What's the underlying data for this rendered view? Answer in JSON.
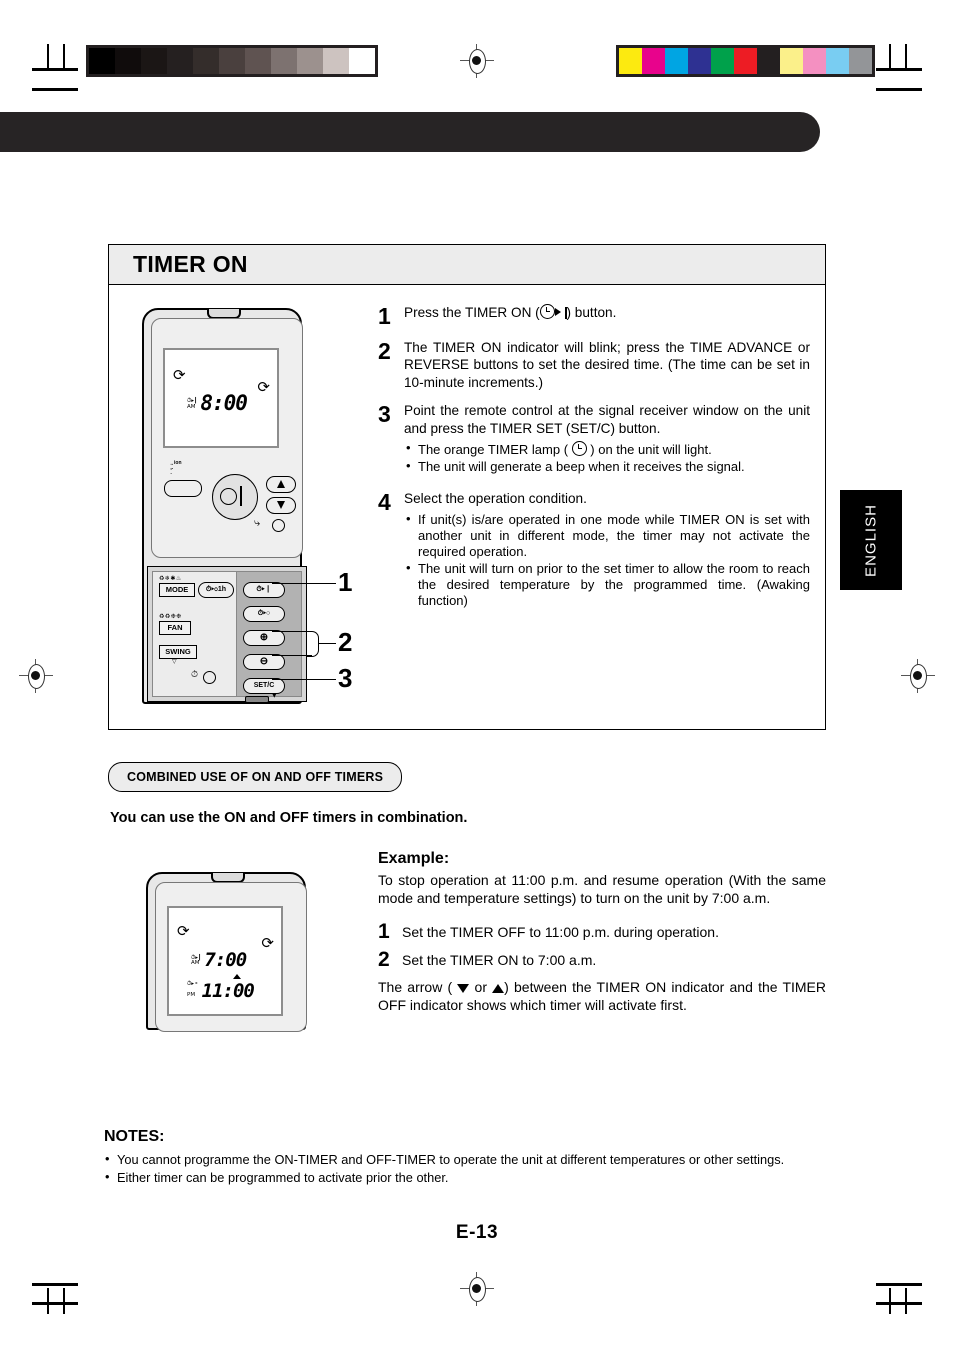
{
  "page": {
    "number_label": "E-13",
    "language_tab": "ENGLISH"
  },
  "colorbars": {
    "grayscale": [
      "#000000",
      "#100c0c",
      "#1b1615",
      "#252020",
      "#342d2b",
      "#4a403e",
      "#5f5351",
      "#7d7270",
      "#9c918e",
      "#cdc3c0",
      "#ffffff"
    ],
    "process": [
      "#fcea10",
      "#e8038c",
      "#00a5e3",
      "#2e3192",
      "#00a14b",
      "#ed1c24",
      "#231f20",
      "#fbf08a",
      "#f490c1",
      "#79cdf2",
      "#939598"
    ]
  },
  "panel": {
    "title": "TIMER ON",
    "steps": [
      {
        "num": "1",
        "text_before": "Press the TIMER ON (",
        "icon": "timer-on-icon",
        "text_after": ") button."
      },
      {
        "num": "2",
        "text": "The TIMER ON indicator will blink; press the TIME ADVANCE or REVERSE buttons to set the desired time. (The time can be set in 10-minute increments.)"
      },
      {
        "num": "3",
        "text": "Point the remote control at the signal receiver window on the unit and press the TIMER SET (SET/C) button.",
        "bullets_before_icon": "The orange TIMER lamp (",
        "bullets_after_icon": ") on the unit will light.",
        "bullet2": "The unit will generate a beep when it receives the signal."
      },
      {
        "num": "4",
        "text": "Select the operation condition.",
        "bullet1": "If unit(s) is/are operated in one mode while TIMER ON is set with another unit in different mode, the timer may not activate the required operation.",
        "bullet2": "The unit will turn on prior to the set timer to allow the room to reach the desired temperature by the programmed time. (Awaking function)"
      }
    ]
  },
  "remote_top": {
    "lcd": {
      "tag_line1": "timer-on-symbol",
      "tag_line2": "AM",
      "time": "8:00",
      "swirl_left": "ion-swirl-icon",
      "swirl_right": "ion-swirl-icon"
    },
    "buttons": {
      "ion_label": "ion",
      "mode": "MODE",
      "one_hour": "1h",
      "fan": "FAN",
      "swing": "SWING",
      "set_c": "SET/C"
    },
    "callouts": [
      "1",
      "2",
      "3"
    ]
  },
  "section": {
    "pill_title": "COMBINED USE OF ON AND OFF TIMERS",
    "lead": "You can use the ON and OFF timers in combination."
  },
  "remote_bottom": {
    "lcd": {
      "tag_on_line1": "timer-on-symbol",
      "tag_on_line2": "AM",
      "time_on": "7:00",
      "tag_off_line1": "timer-off-symbol",
      "tag_off_line2": "PM",
      "time_off": "11:00",
      "arrow": "up-arrow-indicator"
    }
  },
  "example": {
    "heading": "Example:",
    "intro": "To stop operation at 11:00 p.m. and resume operation (With the same mode and temperature settings) to turn on the unit by 7:00 a.m.",
    "steps": [
      {
        "num": "1",
        "text": "Set the TIMER OFF to 11:00 p.m. during operation."
      },
      {
        "num": "2",
        "text": "Set the TIMER ON to 7:00 a.m."
      }
    ],
    "tail_before": "The arrow (",
    "tail_mid": "or",
    "tail_after": ") between the TIMER ON indicator and the TIMER OFF indicator shows which timer will activate first."
  },
  "notes": {
    "heading": "NOTES:",
    "items": [
      "You cannot programme the ON-TIMER and OFF-TIMER to operate the unit at different temperatures or other settings.",
      "Either timer can be programmed to activate prior the other."
    ]
  }
}
